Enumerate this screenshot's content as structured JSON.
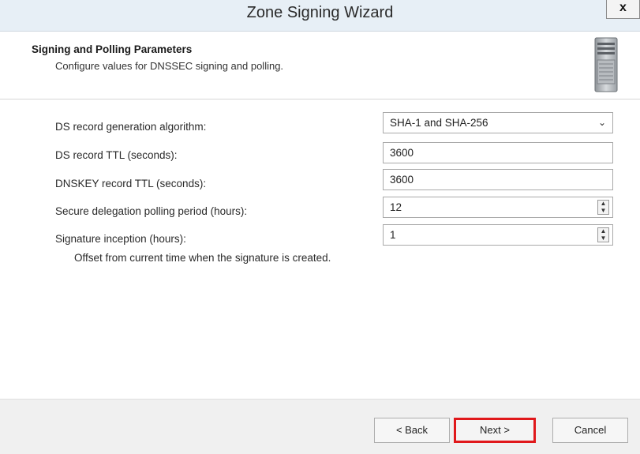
{
  "window": {
    "title": "Zone Signing Wizard",
    "close_label": "x"
  },
  "header": {
    "title": "Signing and Polling Parameters",
    "subtitle": "Configure values for DNSSEC signing and polling.",
    "icon": "server-icon"
  },
  "fields": {
    "ds_algorithm": {
      "label": "DS record generation algorithm:",
      "value": "SHA-1 and SHA-256"
    },
    "ds_ttl": {
      "label": "DS record TTL (seconds):",
      "value": "3600"
    },
    "dnskey_ttl": {
      "label": "DNSKEY record TTL (seconds):",
      "value": "3600"
    },
    "polling_period": {
      "label": "Secure delegation polling period (hours):",
      "value": "12"
    },
    "signature_inception": {
      "label": "Signature inception (hours):",
      "value": "1",
      "hint": "Offset from current time when the signature is created."
    }
  },
  "footer": {
    "back_label": "< Back",
    "next_label": "Next >",
    "cancel_label": "Cancel",
    "highlight_color": "#e0181b"
  }
}
